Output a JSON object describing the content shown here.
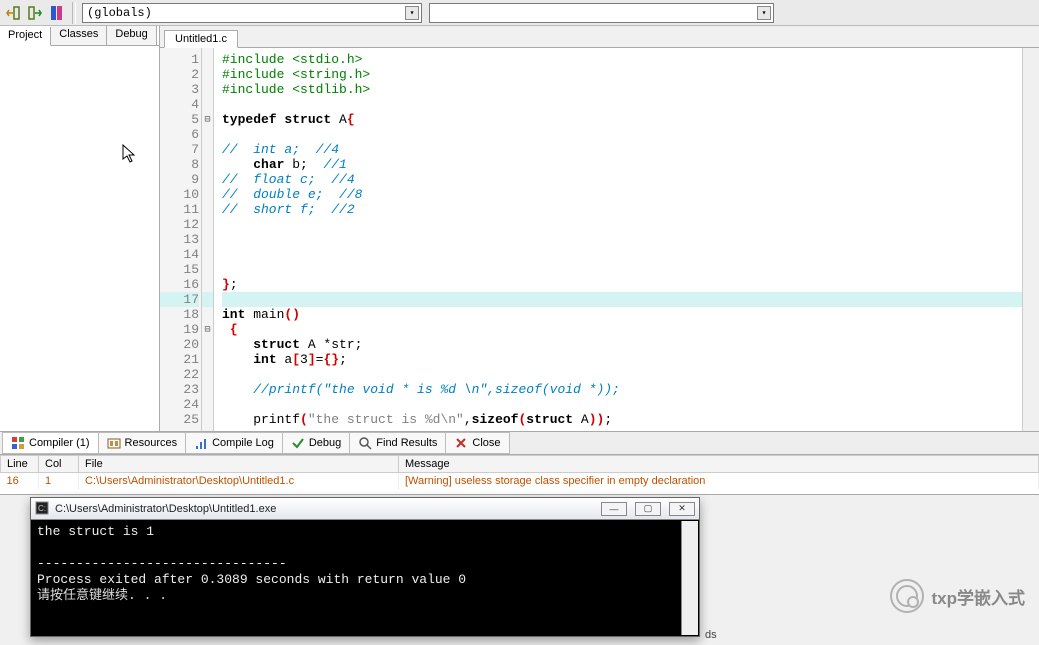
{
  "toolbar": {
    "scope_label": "(globals)"
  },
  "left_tabs": {
    "project": "Project",
    "classes": "Classes",
    "debug": "Debug"
  },
  "file_tab": "Untitled1.c",
  "code": {
    "lines": [
      {
        "n": 1,
        "html": "<span class='c-pre'>#include &lt;stdio.h&gt;</span>"
      },
      {
        "n": 2,
        "html": "<span class='c-pre'>#include &lt;string.h&gt;</span>"
      },
      {
        "n": 3,
        "html": "<span class='c-pre'>#include &lt;stdlib.h&gt;</span>"
      },
      {
        "n": 4,
        "html": ""
      },
      {
        "n": 5,
        "fold": "⊟",
        "html": "<span class='c-kw'>typedef</span> <span class='c-kw'>struct</span> A<span class='c-br'>{</span>"
      },
      {
        "n": 6,
        "html": ""
      },
      {
        "n": 7,
        "html": "<span class='c-cmt'>//  int a;  //4</span>"
      },
      {
        "n": 8,
        "html": "    <span class='c-kw'>char</span> b;  <span class='c-cmt'>//1</span>"
      },
      {
        "n": 9,
        "html": "<span class='c-cmt'>//  float c;  //4</span>"
      },
      {
        "n": 10,
        "html": "<span class='c-cmt'>//  double e;  //8</span>"
      },
      {
        "n": 11,
        "html": "<span class='c-cmt'>//  short f;  //2</span>"
      },
      {
        "n": 12,
        "html": ""
      },
      {
        "n": 13,
        "html": ""
      },
      {
        "n": 14,
        "html": ""
      },
      {
        "n": 15,
        "html": ""
      },
      {
        "n": 16,
        "html": "<span class='c-br'>}</span>;"
      },
      {
        "n": 17,
        "hl": true,
        "html": ""
      },
      {
        "n": 18,
        "html": "<span class='c-kw'>int</span> main<span class='c-br'>()</span>"
      },
      {
        "n": 19,
        "fold": "⊟",
        "html": " <span class='c-br'>{</span>"
      },
      {
        "n": 20,
        "html": "    <span class='c-kw'>struct</span> A *str;"
      },
      {
        "n": 21,
        "html": "    <span class='c-kw'>int</span> a<span class='c-br'>[</span>3<span class='c-br'>]</span>=<span class='c-br'>{}</span>;"
      },
      {
        "n": 22,
        "html": ""
      },
      {
        "n": 23,
        "html": "    <span class='c-cmt'>//printf(\"the void * is %d \\n\",sizeof(void *));</span>"
      },
      {
        "n": 24,
        "html": ""
      },
      {
        "n": 25,
        "html": "    printf<span class='c-br'>(</span><span class='c-str'>\"the struct is %d\\n\"</span>,<span class='c-kw'>sizeof</span><span class='c-br'>(</span><span class='c-kw'>struct</span> A<span class='c-br'>))</span>;"
      }
    ]
  },
  "bottom_tabs": {
    "compiler": "Compiler (1)",
    "resources": "Resources",
    "compile_log": "Compile Log",
    "debug": "Debug",
    "find": "Find Results",
    "close": "Close"
  },
  "msg_headers": {
    "line": "Line",
    "col": "Col",
    "file": "File",
    "message": "Message"
  },
  "msg_row": {
    "line": "16",
    "col": "1",
    "file": "C:\\Users\\Administrator\\Desktop\\Untitled1.c",
    "message": "[Warning] useless storage class specifier in empty declaration"
  },
  "console": {
    "title": "C:\\Users\\Administrator\\Desktop\\Untitled1.exe",
    "line1": "the struct is 1",
    "sep": "--------------------------------",
    "line2": "Process exited after 0.3089 seconds with return value 0",
    "line3": "请按任意键继续. . ."
  },
  "watermark": "txp学嵌入式",
  "footer_hint": "ds"
}
